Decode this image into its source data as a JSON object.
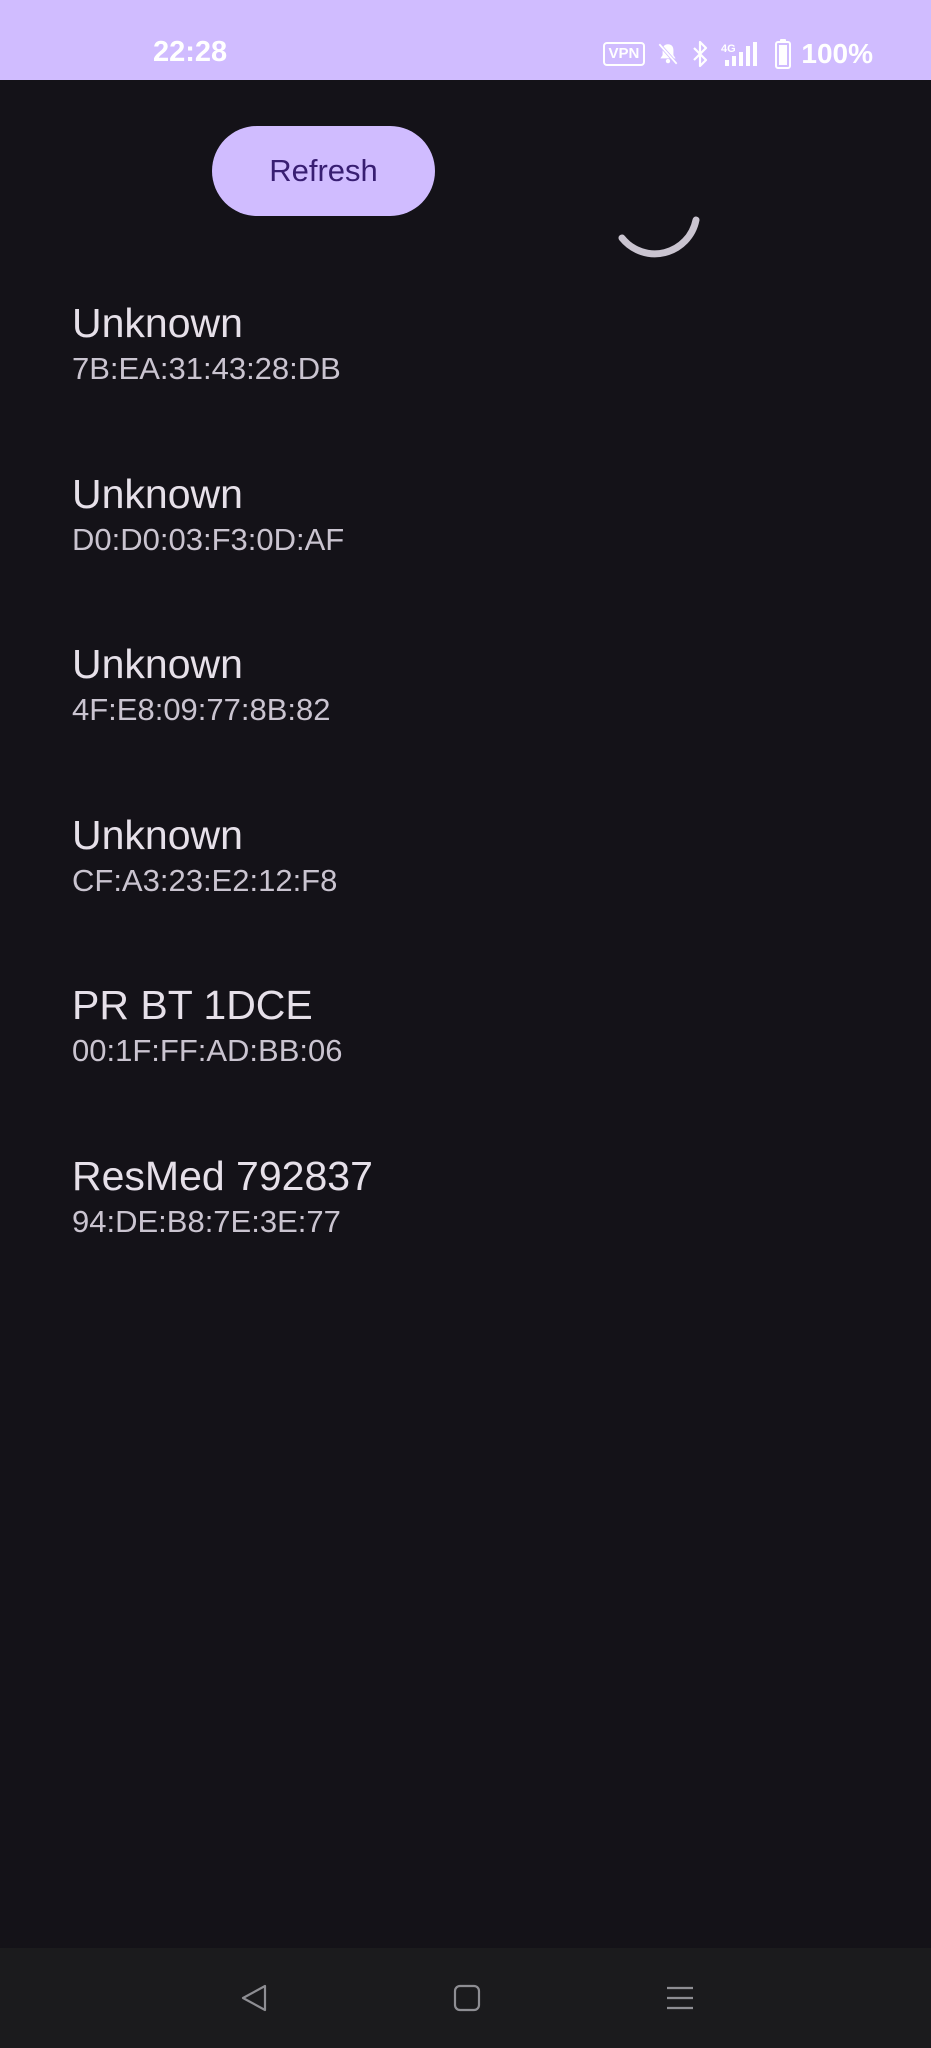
{
  "status_bar": {
    "time": "22:28",
    "vpn_label": "VPN",
    "network_label": "4G",
    "battery_percent": "100%",
    "icons": [
      "vpn-icon",
      "bell-muted-icon",
      "bluetooth-icon",
      "signal-icon",
      "battery-icon"
    ],
    "background_color": "#d0bcff"
  },
  "toolbar": {
    "refresh_label": "Refresh",
    "button_color": "#d0bcff",
    "button_text_color": "#381e72",
    "loading": true
  },
  "devices": [
    {
      "name": "Unknown",
      "address": "7B:EA:31:43:28:DB"
    },
    {
      "name": "Unknown",
      "address": "D0:D0:03:F3:0D:AF"
    },
    {
      "name": "Unknown",
      "address": "4F:E8:09:77:8B:82"
    },
    {
      "name": "Unknown",
      "address": "CF:A3:23:E2:12:F8"
    },
    {
      "name": "PR BT 1DCE",
      "address": "00:1F:FF:AD:BB:06"
    },
    {
      "name": "ResMed 792837",
      "address": "94:DE:B8:7E:3E:77"
    }
  ],
  "nav_bar": {
    "icons": [
      "back-icon",
      "home-icon",
      "recents-icon"
    ]
  },
  "colors": {
    "background": "#141218",
    "primary_text": "#e6e0e9",
    "secondary_text": "#cac4d0",
    "nav_background": "#1b1b1d"
  }
}
